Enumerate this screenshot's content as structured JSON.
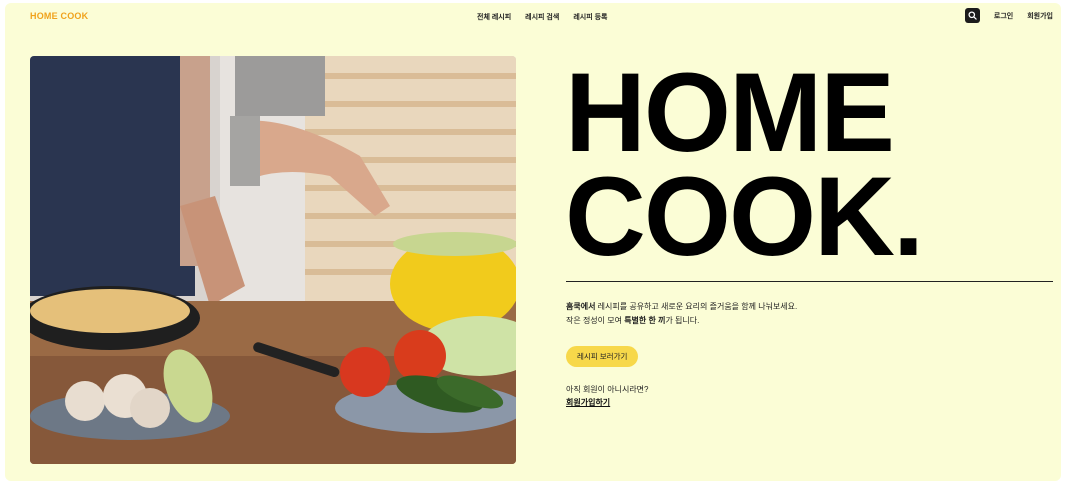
{
  "nav": {
    "logo": "HOME COOK",
    "menu": [
      "전체 레시피",
      "레시피 검색",
      "레시피 등록"
    ],
    "login": "로그인",
    "signup": "회원가입",
    "search_icon": "search-icon"
  },
  "hero": {
    "title_line1": "HOME",
    "title_line2": "COOK.",
    "desc_bold1": "홈쿡에서",
    "desc_rest1": " 레시피를 공유하고 새로운 요리의 즐거움을 함께 나눠보세요.",
    "desc_pre2": "작은 정성이 모여 ",
    "desc_bold2": "특별한 한 끼",
    "desc_post2": "가 됩니다.",
    "cta": "레시피 보러가기",
    "signup_hint": "아직 회원이 아니시라면?",
    "signup_link": "회원가입하기"
  },
  "colors": {
    "page_bg": "#fbfdd6",
    "logo": "#f0a21c",
    "cta_bg": "#f7d84a"
  }
}
